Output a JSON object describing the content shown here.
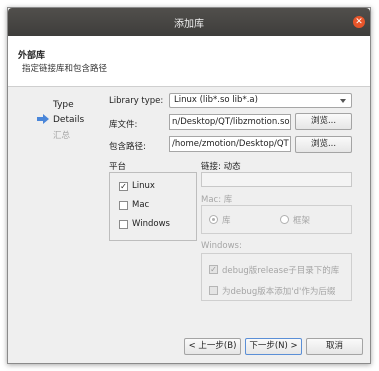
{
  "window": {
    "title": "添加库",
    "close_icon": "close-icon"
  },
  "header": {
    "title": "外部库",
    "subtitle": "指定链接库和包含路径"
  },
  "steps": [
    {
      "label": "Type"
    },
    {
      "label": "Details"
    },
    {
      "label": "汇总"
    }
  ],
  "form": {
    "library_type_label": "Library type:",
    "library_type_value": "Linux (lib*.so lib*.a)",
    "library_file_label": "库文件:",
    "library_file_value": "n/Desktop/QT/libzmotion.so",
    "browse_label": "浏览...",
    "include_path_label": "包含路径:",
    "include_path_value": "/home/zmotion/Desktop/QT"
  },
  "platform": {
    "label": "平台",
    "options": [
      {
        "label": "Linux",
        "checked": true
      },
      {
        "label": "Mac",
        "checked": false
      },
      {
        "label": "Windows",
        "checked": false
      }
    ]
  },
  "link": {
    "label": "链接: 动态"
  },
  "mac": {
    "label": "Mac: 库",
    "options": [
      {
        "label": "库",
        "selected": true
      },
      {
        "label": "框架",
        "selected": false
      }
    ]
  },
  "windows": {
    "label": "Windows:",
    "options": [
      {
        "label": "debug版release子目录下的库",
        "checked": true
      },
      {
        "label": "为debug版本添加'd'作为后缀",
        "checked": false
      }
    ]
  },
  "footer": {
    "back_label": "< 上一步(B)",
    "next_label": "下一步(N) >",
    "cancel_label": "取消"
  },
  "colors": {
    "accent": "#4a86d9",
    "titlebar": "#46443f",
    "close": "#e8552a"
  }
}
